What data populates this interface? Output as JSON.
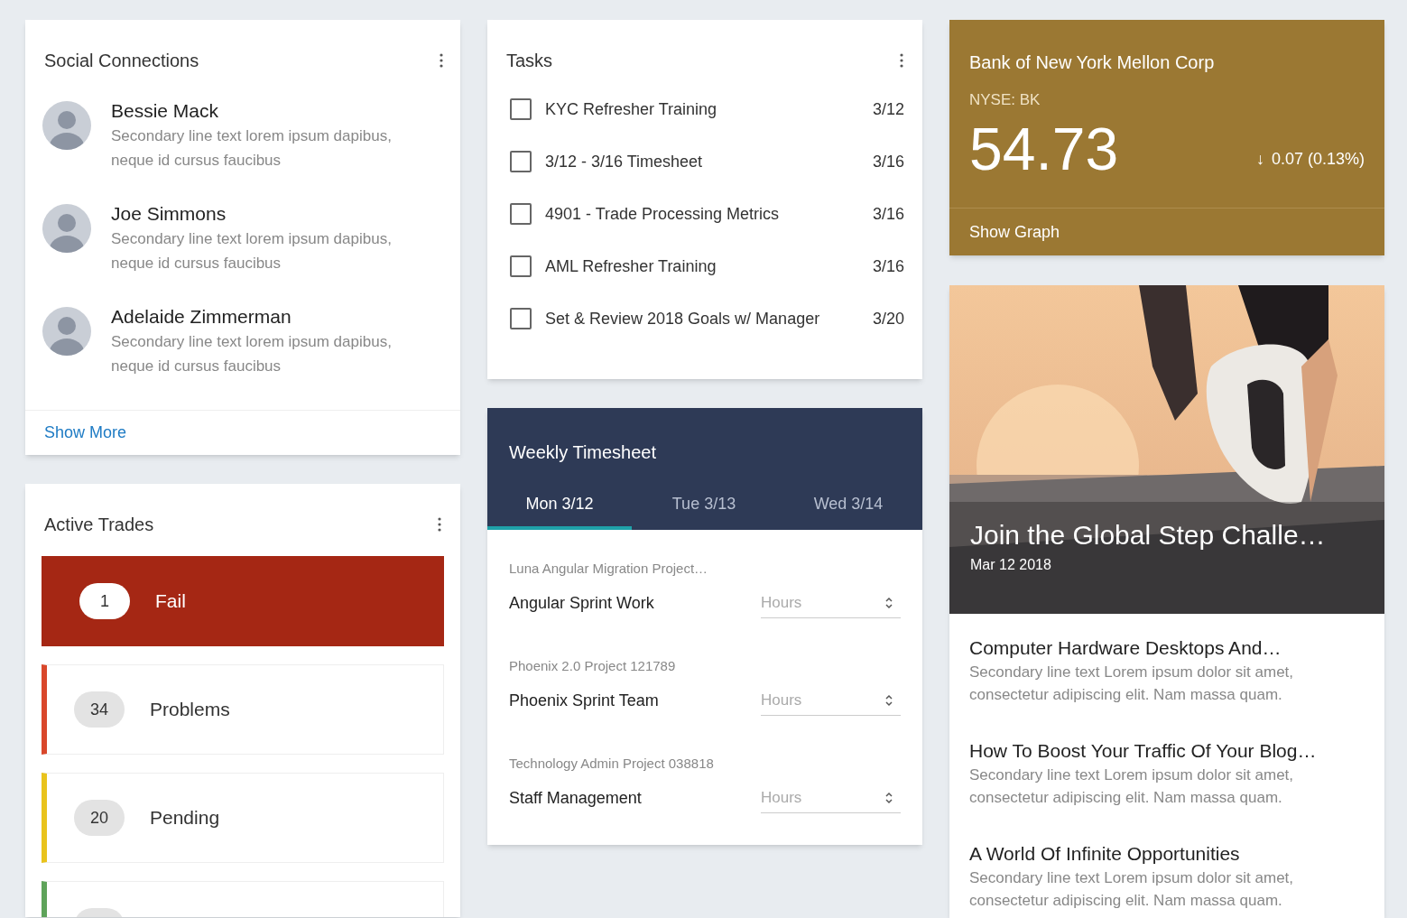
{
  "social_connections": {
    "title": "Social Connections",
    "people": [
      {
        "name": "Bessie Mack",
        "secondary": "Secondary line text lorem ipsum dapibus, neque id cursus faucibus"
      },
      {
        "name": "Joe Simmons",
        "secondary": "Secondary line text lorem ipsum dapibus, neque id cursus faucibus"
      },
      {
        "name": "Adelaide Zimmerman",
        "secondary": "Secondary line text lorem ipsum dapibus, neque id cursus faucibus"
      }
    ],
    "footer_link": "Show More"
  },
  "active_trades": {
    "title": "Active Trades",
    "items": [
      {
        "count": "1",
        "label": "Fail",
        "color": "#a52714",
        "highlighted": true
      },
      {
        "count": "34",
        "label": "Problems",
        "color": "#d9472b",
        "highlighted": false
      },
      {
        "count": "20",
        "label": "Pending",
        "color": "#e9c31c",
        "highlighted": false
      },
      {
        "color": "#5ea35a",
        "highlighted": false
      }
    ]
  },
  "tasks": {
    "title": "Tasks",
    "items": [
      {
        "label": "KYC Refresher Training",
        "due": "3/12",
        "checked": false
      },
      {
        "label": "3/12 - 3/16 Timesheet",
        "due": "3/16",
        "checked": false
      },
      {
        "label": "4901 - Trade Processing Metrics",
        "due": "3/16",
        "checked": false
      },
      {
        "label": "AML Refresher Training",
        "due": "3/16",
        "checked": false
      },
      {
        "label": "Set & Review 2018 Goals w/ Manager",
        "due": "3/20",
        "checked": false
      }
    ]
  },
  "weekly_timesheet": {
    "title": "Weekly Timesheet",
    "tabs": [
      {
        "label": "Mon 3/12",
        "selected": true
      },
      {
        "label": "Tue 3/13",
        "selected": false
      },
      {
        "label": "Wed 3/14",
        "selected": false
      }
    ],
    "entries": [
      {
        "project": "Luna Angular Migration Project…",
        "task": "Angular Sprint Work",
        "placeholder": "Hours"
      },
      {
        "project": "Phoenix 2.0 Project 121789",
        "task": "Phoenix Sprint Team",
        "placeholder": "Hours"
      },
      {
        "project": "Technology Admin Project 038818",
        "task": "Staff Management",
        "placeholder": "Hours"
      }
    ]
  },
  "stock": {
    "name": "Bank of New York Mellon Corp",
    "ticker": "NYSE: BK",
    "price": "54.73",
    "change_arrow": "↓",
    "change": "0.07 (0.13%)",
    "action": "Show Graph"
  },
  "feature": {
    "title": "Join the Global Step Challe…",
    "date": "Mar 12 2018",
    "articles": [
      {
        "title": "Computer Hardware Desktops And…",
        "secondary": "Secondary line text Lorem ipsum dolor sit amet, consectetur adipiscing elit. Nam massa quam."
      },
      {
        "title": "How To Boost Your Traffic Of Your Blog…",
        "secondary": "Secondary line text Lorem ipsum dolor sit amet, consectetur adipiscing elit. Nam massa quam."
      },
      {
        "title": "A World Of Infinite Opportunities",
        "secondary": "Secondary line text Lorem ipsum dolor sit amet, consectetur adipiscing elit. Nam massa quam."
      }
    ]
  }
}
